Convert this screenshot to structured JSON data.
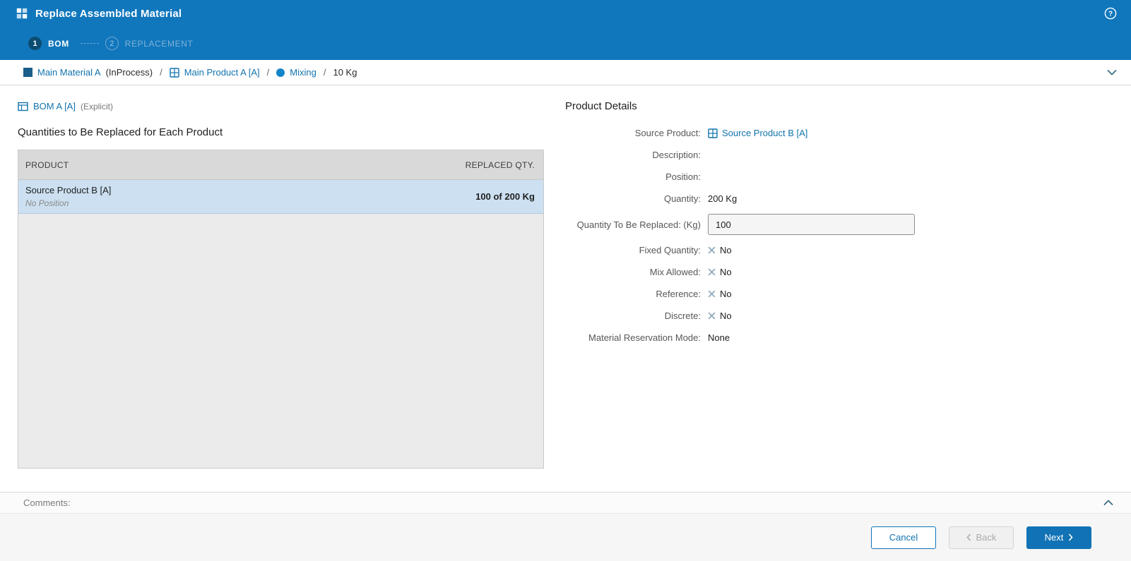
{
  "header": {
    "title": "Replace Assembled Material"
  },
  "wizard": {
    "steps": [
      {
        "number": "1",
        "label": "BOM"
      },
      {
        "number": "2",
        "label": "REPLACEMENT"
      }
    ]
  },
  "breadcrumb": {
    "material": "Main Material A",
    "material_state": "(InProcess)",
    "product": "Main Product A [A]",
    "step": "Mixing",
    "quantity": "10 Kg",
    "separator": "/"
  },
  "bom_header": {
    "name": "BOM A [A]",
    "type": "(Explicit)"
  },
  "quantities": {
    "heading": "Quantities to Be Replaced for Each Product",
    "columns": {
      "product": "PRODUCT",
      "replaced_qty": "REPLACED QTY."
    },
    "rows": [
      {
        "product": "Source Product B [A]",
        "position": "No Position",
        "replaced_qty": "100 of 200 Kg"
      }
    ]
  },
  "details": {
    "heading": "Product Details",
    "source_product": {
      "label": "Source Product:",
      "value": "Source Product B [A]"
    },
    "description": {
      "label": "Description:",
      "value": ""
    },
    "position": {
      "label": "Position:",
      "value": ""
    },
    "quantity": {
      "label": "Quantity:",
      "value": "200 Kg"
    },
    "quantity_to_replace": {
      "label": "Quantity To Be Replaced: (Kg)",
      "value": "100"
    },
    "fixed_quantity": {
      "label": "Fixed Quantity:",
      "value": "No"
    },
    "mix_allowed": {
      "label": "Mix Allowed:",
      "value": "No"
    },
    "reference": {
      "label": "Reference:",
      "value": "No"
    },
    "discrete": {
      "label": "Discrete:",
      "value": "No"
    },
    "material_reservation_mode": {
      "label": "Material Reservation Mode:",
      "value": "None"
    }
  },
  "comments": {
    "label": "Comments:"
  },
  "footer": {
    "cancel": "Cancel",
    "back": "Back",
    "next": "Next"
  },
  "colors": {
    "header_blue": "#1177BD",
    "link_blue": "#1273AE",
    "selected_row": "#CCE0F1",
    "primary_button": "#1173B5",
    "active_step_circle": "#0B4C72"
  }
}
